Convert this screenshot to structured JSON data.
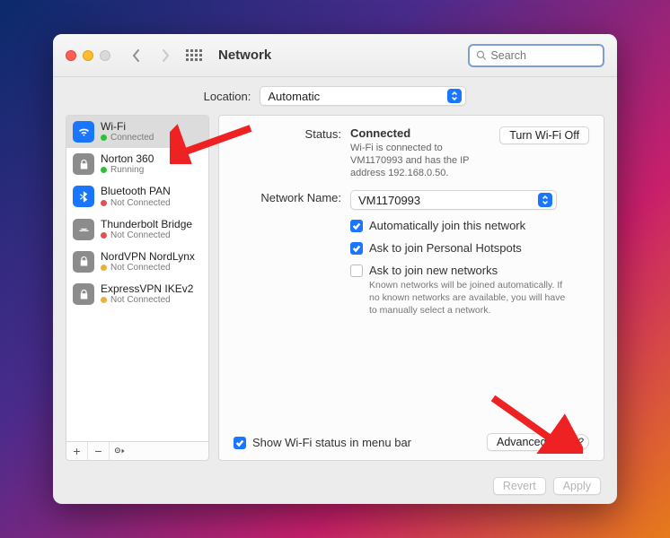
{
  "window": {
    "title": "Network"
  },
  "search": {
    "placeholder": "Search"
  },
  "location": {
    "label": "Location:",
    "value": "Automatic"
  },
  "sidebar": {
    "items": [
      {
        "name": "Wi-Fi",
        "status": "Connected",
        "icon": "wifi",
        "dot": "green"
      },
      {
        "name": "Norton 360",
        "status": "Running",
        "icon": "lock",
        "dot": "green"
      },
      {
        "name": "Bluetooth PAN",
        "status": "Not Connected",
        "icon": "bt",
        "dot": "red"
      },
      {
        "name": "Thunderbolt Bridge",
        "status": "Not Connected",
        "icon": "thunder",
        "dot": "red"
      },
      {
        "name": "NordVPN NordLynx",
        "status": "Not Connected",
        "icon": "lock",
        "dot": "yellow"
      },
      {
        "name": "ExpressVPN IKEv2",
        "status": "Not Connected",
        "icon": "lock",
        "dot": "yellow"
      }
    ]
  },
  "detail": {
    "status_label": "Status:",
    "status_value": "Connected",
    "status_desc": "Wi-Fi is connected to VM1170993 and has the IP address 192.168.0.50.",
    "turn_off_label": "Turn Wi-Fi Off",
    "network_name_label": "Network Name:",
    "network_name_value": "VM1170993",
    "cb_auto_join": "Automatically join this network",
    "cb_personal_hotspots": "Ask to join Personal Hotspots",
    "cb_ask_new": "Ask to join new networks",
    "cb_ask_new_desc": "Known networks will be joined automatically. If no known networks are available, you will have to manually select a network.",
    "cb_menubar": "Show Wi-Fi status in menu bar",
    "advanced_label": "Advanced...",
    "help_label": "?"
  },
  "footer": {
    "revert": "Revert",
    "apply": "Apply"
  }
}
